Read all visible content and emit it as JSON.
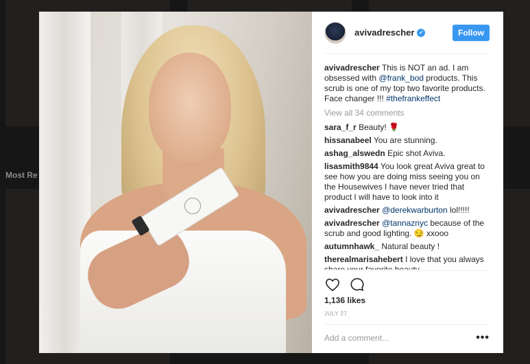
{
  "background": {
    "section_label": "Most Re"
  },
  "post": {
    "image_alt": "Woman in white towel holding a skincare tube"
  },
  "header": {
    "username": "avivadrescher",
    "verified_icon": "verified-check",
    "follow_label": "Follow"
  },
  "caption": {
    "username": "avivadrescher",
    "text_1": "This is NOT an ad. I am obsessed with",
    "mention": "@frank_bod",
    "text_2": "products. This scrub is one of my top two favorite products. Face changer !!!",
    "hashtag": "#thefrankeffect"
  },
  "view_all_comments": "View all 34 comments",
  "comments": [
    {
      "user": "sara_f_r",
      "text": "Beauty! 🌹"
    },
    {
      "user": "hissanabeel",
      "text": "You are stunning."
    },
    {
      "user": "ashag_alswedn",
      "text": "Epic shot Aviva."
    },
    {
      "user": "lisasmith9844",
      "text": "You look great Aviva great to see how you are doing miss seeing you on the Housewives I have never tried that product I will have to look into it"
    },
    {
      "user": "avivadrescher",
      "mention": "@derekwarburton",
      "text": "lol!!!!!"
    },
    {
      "user": "avivadrescher",
      "mention": "@tannaznyc",
      "text": "because of the scrub and good lighting. 😏 xxooo"
    },
    {
      "user": "autumnhawk_",
      "text": "Natural beauty !"
    },
    {
      "user": "therealmarisahebert",
      "text": "I love that you always share your favorite beauty"
    }
  ],
  "actions": {
    "like_icon": "heart-outline",
    "comment_icon": "speech-bubble"
  },
  "likes": "1,136 likes",
  "date": "JULY 27",
  "add_comment_placeholder": "Add a comment...",
  "more_options": "•••",
  "colors": {
    "accent": "#3897f0",
    "mention": "#003569",
    "muted": "#999999",
    "text": "#262626"
  }
}
